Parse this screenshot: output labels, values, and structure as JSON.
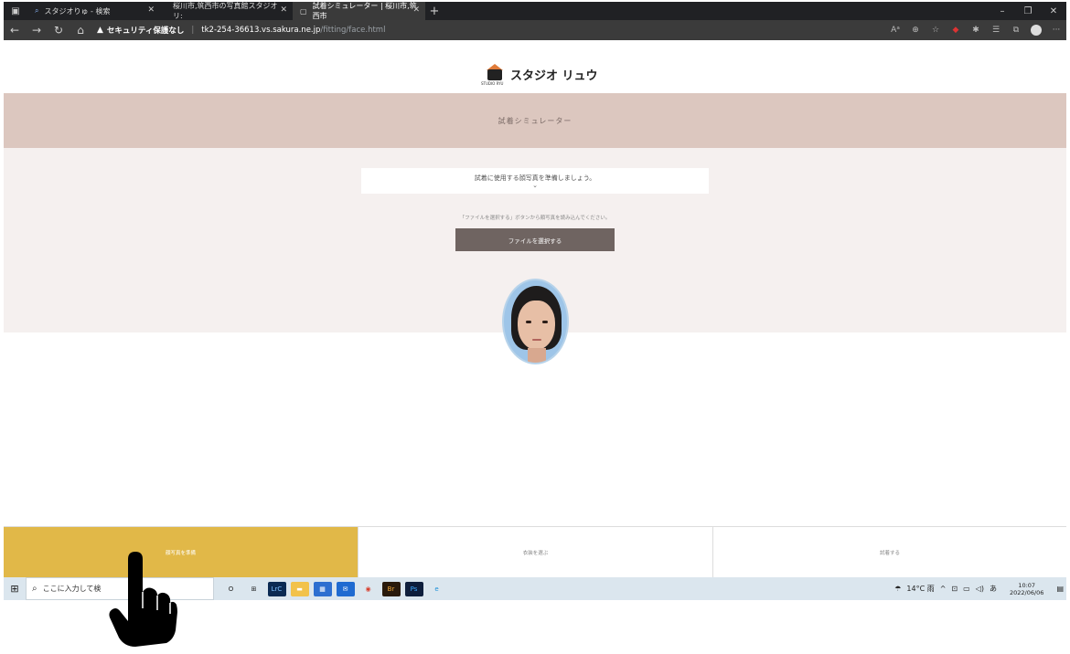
{
  "browser": {
    "tabs": [
      {
        "label": "スタジオりゅ - 検索",
        "icon": "search-icon",
        "active": false
      },
      {
        "label": "桜川市,筑西市の写真館スタジオリ:",
        "icon": "",
        "active": false
      },
      {
        "label": "試着シミュレーター | 桜川市,筑西市",
        "icon": "page-icon",
        "active": true
      }
    ],
    "security_label": "セキュリティ保護なし",
    "url_host": "tk2-254-36613.vs.sakura.ne.jp",
    "url_path": "/fitting/face.html"
  },
  "site": {
    "logo_text": "スタジオ リュウ",
    "logo_sub": "STUDIO RYU",
    "band_title": "試着シミュレーター",
    "step_text": "試着に使用する顔写真を準備しましょう。",
    "hint_text": "「ファイルを選択する」ボタンから顔写真を読み込んでください。",
    "file_button": "ファイルを選択する",
    "bottom_tabs": [
      {
        "label": "顔写真を準備",
        "active": true
      },
      {
        "label": "衣装を選ぶ",
        "active": false
      },
      {
        "label": "試着する",
        "active": false
      }
    ]
  },
  "taskbar": {
    "search_placeholder": "ここに入力して検",
    "weather": "14°C 雨",
    "ime": "あ",
    "time": "10:07",
    "date": "2022/06/06",
    "apps": [
      {
        "name": "cortana-icon",
        "glyph": "O",
        "color": "#dbe6ee",
        "text": "#222"
      },
      {
        "name": "task-view-icon",
        "glyph": "⊞",
        "color": "#dbe6ee",
        "text": "#222"
      },
      {
        "name": "lrc-icon",
        "glyph": "LrC",
        "color": "#0b2a52",
        "text": "#7fc1ff"
      },
      {
        "name": "explorer-icon",
        "glyph": "▬",
        "color": "#f2c24b",
        "text": "#fff"
      },
      {
        "name": "store-icon",
        "glyph": "▦",
        "color": "#2d6fd0",
        "text": "#fff"
      },
      {
        "name": "mail-icon",
        "glyph": "✉",
        "color": "#1f6bd1",
        "text": "#fff"
      },
      {
        "name": "chrome-icon",
        "glyph": "◉",
        "color": "#dbe6ee",
        "text": "#d8402e"
      },
      {
        "name": "bridge-icon",
        "glyph": "Br",
        "color": "#2a1a0b",
        "text": "#f2a93b"
      },
      {
        "name": "photoshop-icon",
        "glyph": "Ps",
        "color": "#0e1e3c",
        "text": "#3fa9ff"
      },
      {
        "name": "edge-icon",
        "glyph": "e",
        "color": "#dbe6ee",
        "text": "#1a8fd8"
      }
    ]
  }
}
